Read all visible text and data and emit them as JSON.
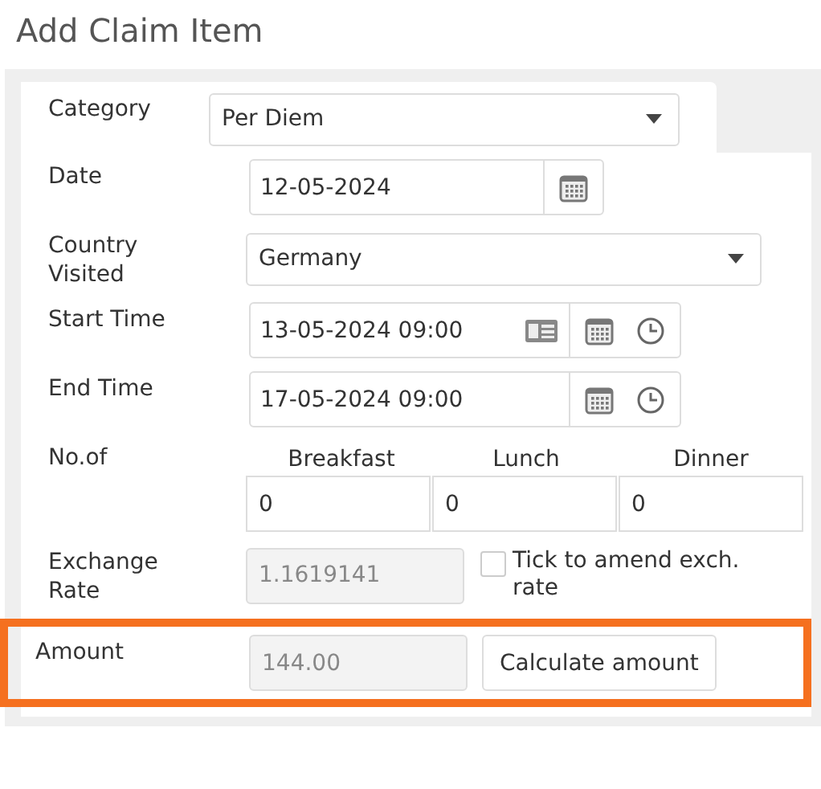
{
  "title": "Add Claim Item",
  "category": {
    "label": "Category",
    "value": "Per Diem"
  },
  "rows": [
    {
      "kind": "date",
      "label": "Date",
      "value": "12-05-2024"
    },
    {
      "kind": "select",
      "label": "Country Visited",
      "value": "Germany"
    },
    {
      "kind": "datetime",
      "label": "Start Time",
      "value": "13-05-2024 09:00",
      "card_icon": true
    },
    {
      "kind": "datetime",
      "label": "End Time",
      "value": "17-05-2024 09:00",
      "card_icon": false
    },
    {
      "kind": "meals",
      "label": "No.of",
      "meals": [
        {
          "heading": "Breakfast",
          "value": "0"
        },
        {
          "heading": "Lunch",
          "value": "0"
        },
        {
          "heading": "Dinner",
          "value": "0"
        }
      ]
    },
    {
      "kind": "exchange",
      "label": "Exchange Rate",
      "value": "1.1619141",
      "disabled": true,
      "checkbox": {
        "label": "Tick to amend exch. rate",
        "checked": false
      }
    },
    {
      "kind": "amount",
      "label": "Amount",
      "value": "144.00",
      "disabled": true,
      "button": "Calculate amount",
      "highlighted": true
    }
  ]
}
